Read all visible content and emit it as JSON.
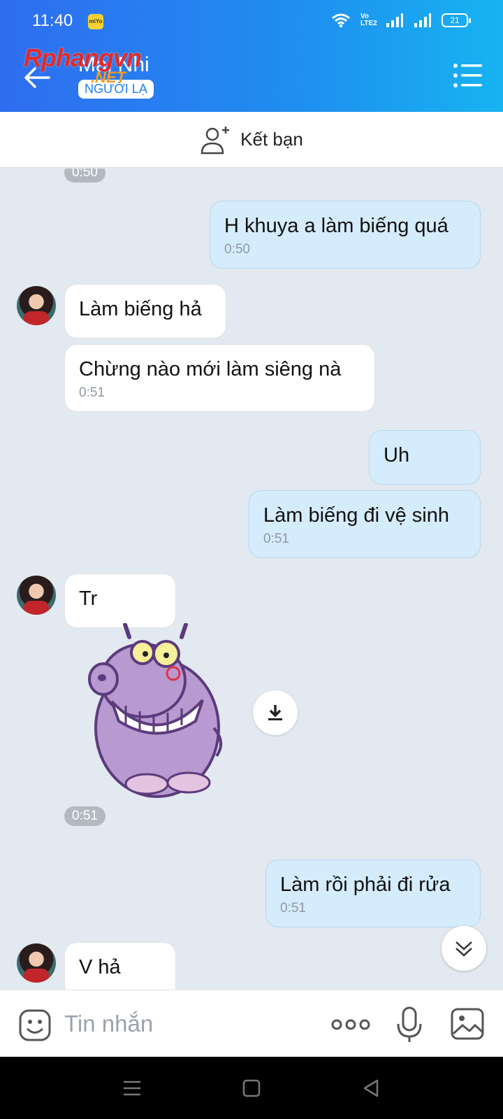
{
  "status_bar": {
    "time": "11:40",
    "app_badge": "miYo",
    "volte": "Vo LTE2",
    "battery": "21"
  },
  "header": {
    "contact_name": "Mai Nhi",
    "stranger_badge": "NGƯỜI LẠ",
    "watermark": "Rphangvn",
    "watermark_sub": ".NET",
    "colors": {
      "gradient_start": "#2f6df0",
      "gradient_end": "#17b3f0"
    }
  },
  "add_friend": {
    "label": "Kết bạn"
  },
  "messages": [
    {
      "type": "time",
      "text": "0:50"
    },
    {
      "type": "out",
      "text": "H khuya a làm biếng quá",
      "time": "0:50"
    },
    {
      "type": "in",
      "text": "Làm biếng hả",
      "time": ""
    },
    {
      "type": "in",
      "text": "Chừng nào mới làm siêng nà",
      "time": "0:51"
    },
    {
      "type": "out",
      "text": "Uh",
      "time": ""
    },
    {
      "type": "out",
      "text": "Làm biếng đi vệ sinh",
      "time": "0:51"
    },
    {
      "type": "in",
      "text": "Tr",
      "time": ""
    },
    {
      "type": "in_sticker",
      "sticker": "purple hippo grinning sticker",
      "time": "0:51"
    },
    {
      "type": "out",
      "text": "Làm rồi phải đi rửa",
      "time": "0:51"
    },
    {
      "type": "in",
      "text": "V hả",
      "time": ""
    }
  ],
  "input_bar": {
    "placeholder": "Tin nhắn",
    "icons": [
      "emoji-icon",
      "more-icon",
      "microphone-icon",
      "image-icon"
    ]
  },
  "nav_bar": {
    "icons": [
      "menu-icon",
      "home-icon",
      "back-icon"
    ]
  }
}
